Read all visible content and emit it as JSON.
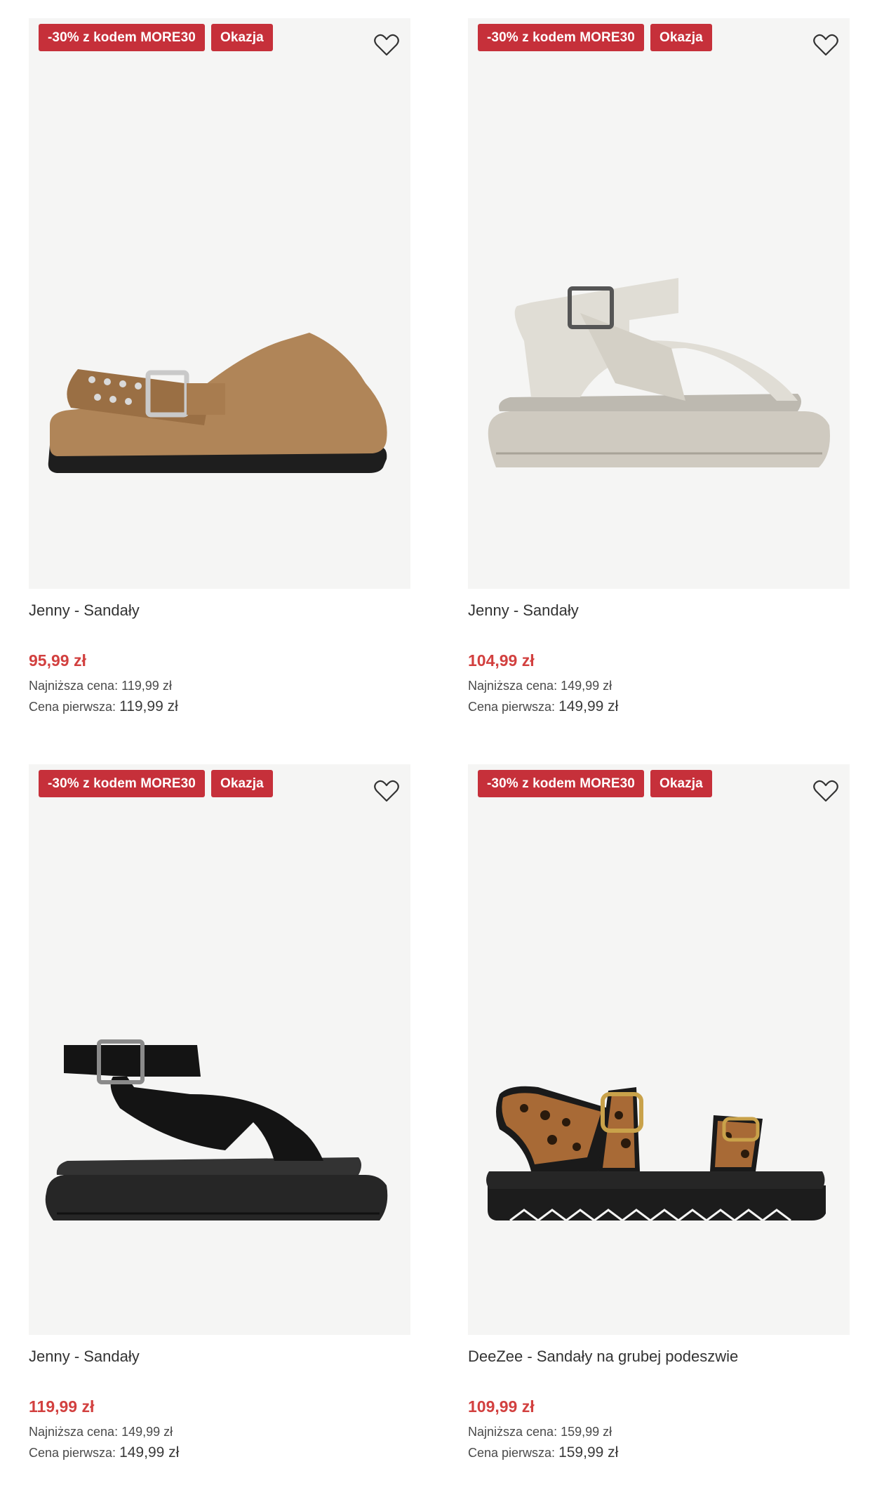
{
  "products": [
    {
      "promo_badge": "-30% z kodem MORE30",
      "deal_badge": "Okazja",
      "name": "Jenny - Sandały",
      "price": "95,99 zł",
      "lowest_label": "Najniższa cena:",
      "lowest_value": "119,99 zł",
      "original_label": "Cena pierwsza:",
      "original_value": "119,99 zł"
    },
    {
      "promo_badge": "-30% z kodem MORE30",
      "deal_badge": "Okazja",
      "name": "Jenny - Sandały",
      "price": "104,99 zł",
      "lowest_label": "Najniższa cena:",
      "lowest_value": "149,99 zł",
      "original_label": "Cena pierwsza:",
      "original_value": "149,99 zł"
    },
    {
      "promo_badge": "-30% z kodem MORE30",
      "deal_badge": "Okazja",
      "name": "Jenny - Sandały",
      "price": "119,99 zł",
      "lowest_label": "Najniższa cena:",
      "lowest_value": "149,99 zł",
      "original_label": "Cena pierwsza:",
      "original_value": "149,99 zł"
    },
    {
      "promo_badge": "-30% z kodem MORE30",
      "deal_badge": "Okazja",
      "name": "DeeZee - Sandały na grubej podeszwie",
      "price": "109,99 zł",
      "lowest_label": "Najniższa cena:",
      "lowest_value": "159,99 zł",
      "original_label": "Cena pierwsza:",
      "original_value": "159,99 zł"
    }
  ],
  "colors": {
    "badge": "#c6303a",
    "price": "#d2403f",
    "image_bg": "#f5f5f4"
  },
  "icons": {
    "wishlist": "heart-outline-icon"
  }
}
